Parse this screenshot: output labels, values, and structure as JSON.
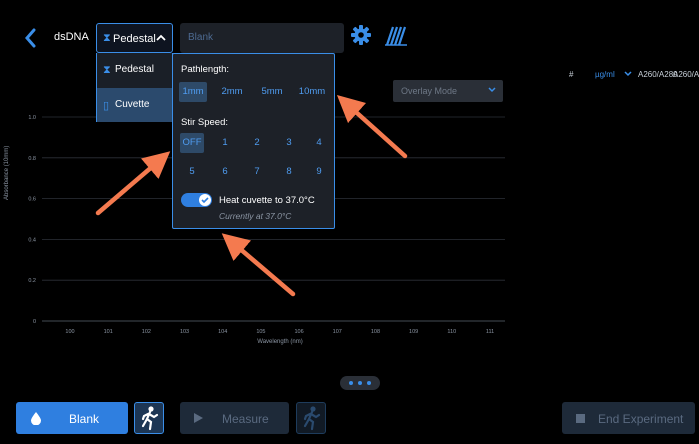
{
  "header": {
    "sample_type": "dsDNA",
    "mode_selected": "Pedestal",
    "blank_placeholder": "Blank"
  },
  "mode_menu": {
    "items": [
      {
        "label": "Pedestal",
        "icon": "pedestal-icon",
        "selected": false
      },
      {
        "label": "Cuvette",
        "icon": "cuvette-icon",
        "selected": true
      }
    ]
  },
  "settings": {
    "pathlength_label": "Pathlength:",
    "pathlength_options": [
      "1mm",
      "2mm",
      "5mm",
      "10mm"
    ],
    "pathlength_selected": "1mm",
    "stir_label": "Stir Speed:",
    "stir_options": [
      "OFF",
      "1",
      "2",
      "3",
      "4",
      "5",
      "6",
      "7",
      "8",
      "9"
    ],
    "stir_selected": "OFF",
    "heat_label": "Heat cuvette to 37.0°C",
    "heat_enabled": true,
    "current_temp": "Currently at 37.0°C"
  },
  "results": {
    "col_hash": "#",
    "unit": "µg/ml",
    "col_a260_280": "A260/A280",
    "col_a260_230": "A260/A230"
  },
  "overlay_mode": "Overlay Mode",
  "chart_data": {
    "type": "line",
    "xlabel": "Wavelength (nm)",
    "ylabel": "Absorbance (10mm)",
    "x_ticks": [
      "100",
      "101",
      "102",
      "103",
      "104",
      "105",
      "106",
      "107",
      "108",
      "109",
      "110",
      "111"
    ],
    "y_ticks": [
      "0",
      "0.2",
      "0.4",
      "0.6",
      "0.8",
      "1.0"
    ],
    "xlim": [
      100,
      111
    ],
    "ylim": [
      0,
      1.0
    ],
    "series": []
  },
  "page_indicator": {
    "count": 3
  },
  "footer": {
    "blank_label": "Blank",
    "measure_label": "Measure",
    "end_label": "End Experiment"
  },
  "colors": {
    "accent": "#3a8ee8",
    "annotation_arrow": "#f47a4f"
  }
}
